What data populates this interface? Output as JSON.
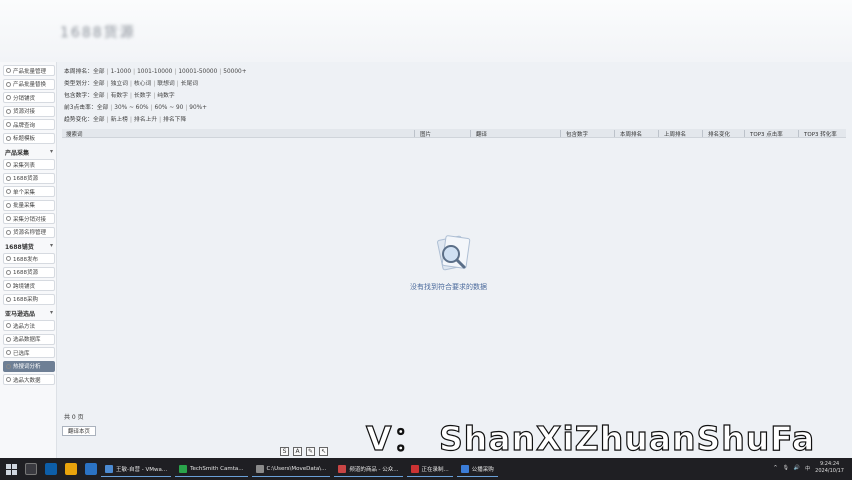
{
  "header": {
    "blurred_title": "1688货源"
  },
  "sidebar": {
    "top_items": [
      "产品批量管理",
      "产品批量替换",
      "分销铺货",
      "货源对接",
      "品牌查询",
      "标题模板"
    ],
    "groups": [
      {
        "title": "产品采集",
        "caret": "▾",
        "items": [
          "采集列表",
          "1688货源",
          "单个采集",
          "批量采集",
          "采集分销对接",
          "货源名称管理"
        ]
      },
      {
        "title": "1688铺货",
        "caret": "▾",
        "items": [
          "1688发布",
          "1688货源",
          "跨境铺货",
          "1688采购"
        ]
      },
      {
        "title": "亚马逊选品",
        "caret": "▾",
        "items": [
          "选品方法",
          "选品数据库",
          "已选库",
          "热搜词分析",
          "选品大数据"
        ]
      }
    ],
    "active_item": "热搜词分析"
  },
  "filters": {
    "rows": [
      {
        "label": "本周排名：",
        "options": [
          "全部",
          "1-1000",
          "1001-10000",
          "10001-50000",
          "50000+"
        ]
      },
      {
        "label": "类型划分：",
        "options": [
          "全部",
          "独立词",
          "核心词",
          "联想词",
          "长尾词"
        ]
      },
      {
        "label": "包含数字：",
        "options": [
          "全部",
          "有数字",
          "长数字",
          "纯数字"
        ]
      },
      {
        "label": "前3点击率：",
        "options": [
          "全部",
          "30% ~ 60%",
          "60% ~ 90",
          "90%+"
        ]
      },
      {
        "label": "趋势变化：",
        "options": [
          "全部",
          "新上榜",
          "排名上升",
          "排名下降"
        ]
      }
    ]
  },
  "table": {
    "columns": [
      "搜索词",
      "图片",
      "翻译",
      "包含数字",
      "本周排名",
      "上周排名",
      "排名变化",
      "TOP3 点击率",
      "TOP3 转化率"
    ]
  },
  "empty_state": {
    "message": "没有找到符合要求的数据"
  },
  "pagination": {
    "total_label": "共 0 页",
    "button_label": "翻译本页"
  },
  "watermark": {
    "text": "V： ShanXiZhuanShuFa"
  },
  "taskbar": {
    "apps": [
      "王敏-自营 - VMwa...",
      "TechSmith Camta...",
      "C:\\Users\\MoveData\\...",
      "频道的商品 - 公众...",
      "正在录制...",
      "公播采购"
    ],
    "clock_time": "9:24:24",
    "clock_date": "2024/10/17"
  }
}
